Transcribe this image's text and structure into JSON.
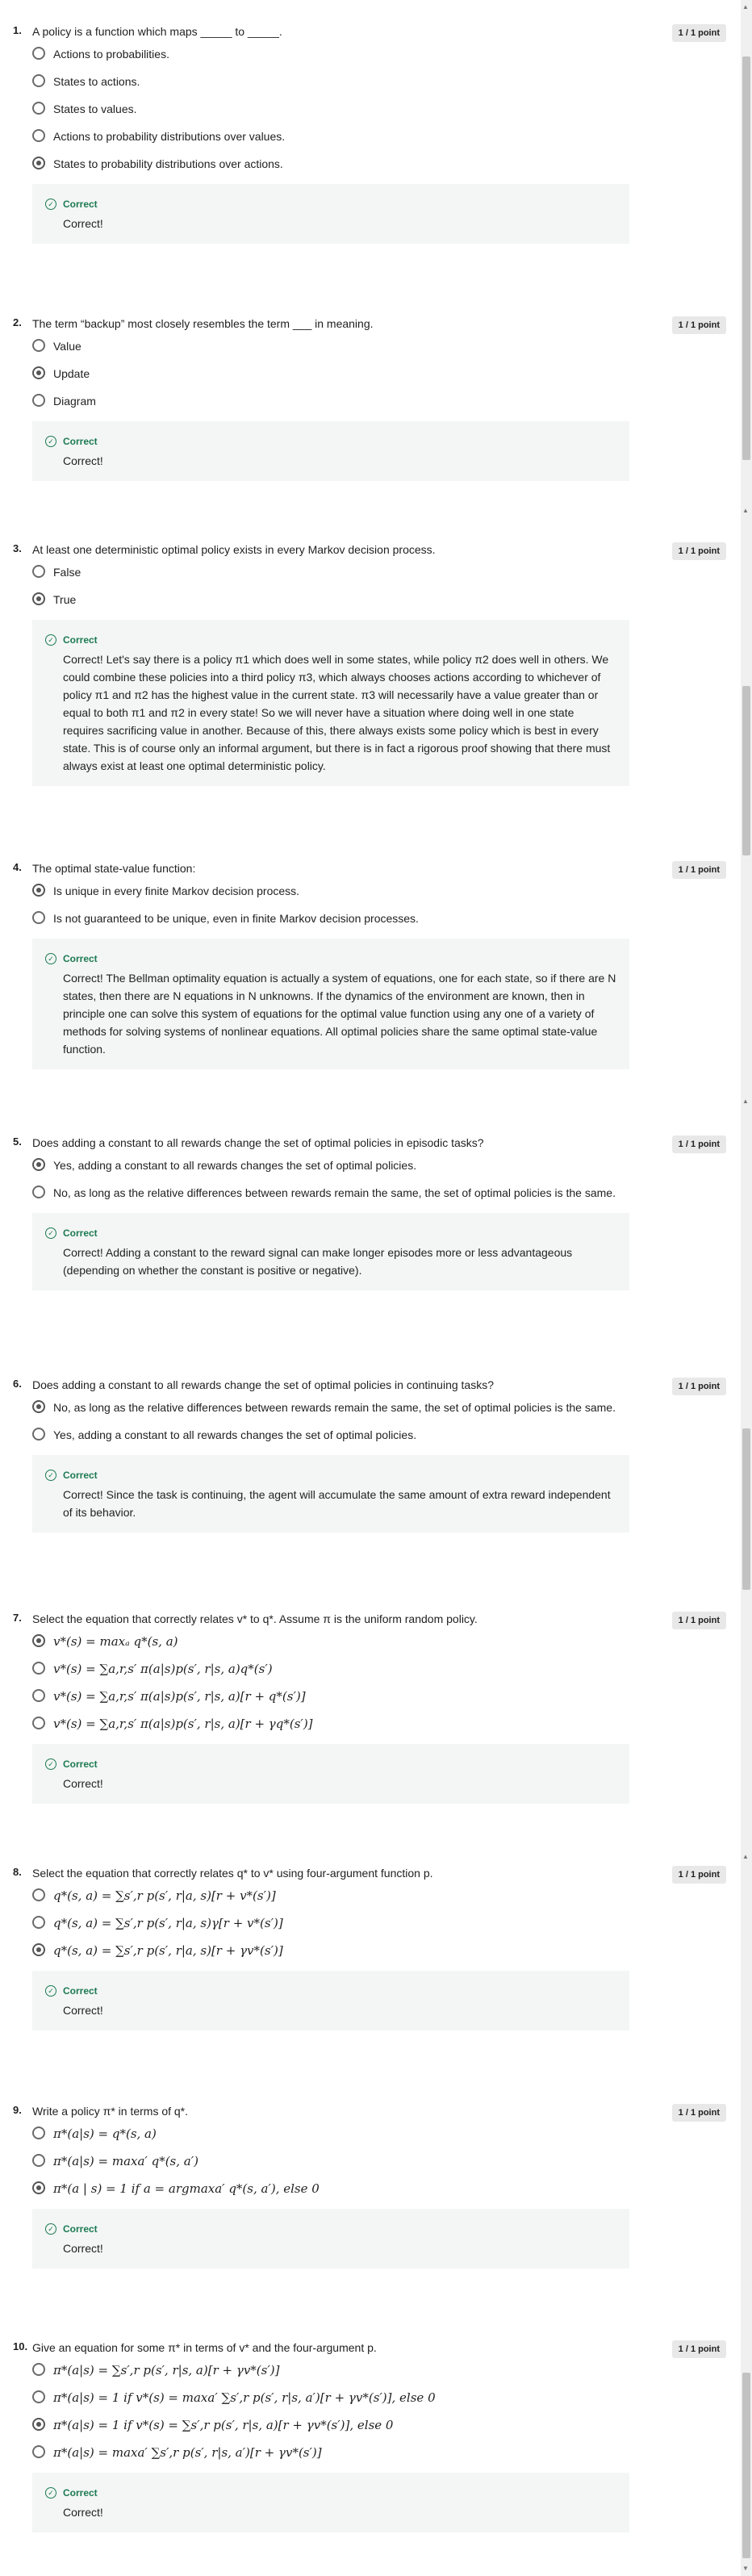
{
  "points_label": "1 / 1 point",
  "feedback_status": "Correct",
  "questions": [
    {
      "number": "1.",
      "text": "A policy is a function which maps _____ to _____.",
      "options": [
        {
          "text": "Actions to probabilities.",
          "selected": false
        },
        {
          "text": "States to actions.",
          "selected": false
        },
        {
          "text": "States to values.",
          "selected": false
        },
        {
          "text": "Actions to probability distributions over values.",
          "selected": false
        },
        {
          "text": "States to probability distributions over actions.",
          "selected": true
        }
      ],
      "feedback": "Correct!"
    },
    {
      "number": "2.",
      "text": "The term “backup” most closely resembles the term ___ in meaning.",
      "options": [
        {
          "text": "Value",
          "selected": false
        },
        {
          "text": "Update",
          "selected": true
        },
        {
          "text": "Diagram",
          "selected": false
        }
      ],
      "feedback": "Correct!"
    },
    {
      "number": "3.",
      "text": "At least one deterministic optimal policy exists in every Markov decision process.",
      "options": [
        {
          "text": "False",
          "selected": false
        },
        {
          "text": "True",
          "selected": true
        }
      ],
      "feedback": "Correct! Let's say there is a policy π1 which does well in some states, while policy π2 does well in others. We could combine these policies into a third policy π3, which always chooses actions according to whichever of policy π1 and π2 has the highest value in the current state.  π3 will necessarily have a value greater than or equal to both π1 and π2 in every state! So we will never have a situation where doing well in one state requires sacrificing value in another.  Because of this, there always exists some policy which is best in every state. This is of course only an informal argument, but there is in fact a rigorous proof showing that there must always exist at least one optimal deterministic policy."
    },
    {
      "number": "4.",
      "text": "The optimal state-value function:",
      "options": [
        {
          "text": "Is unique in every finite Markov decision process.",
          "selected": true
        },
        {
          "text": "Is not guaranteed to be unique, even in finite Markov decision processes.",
          "selected": false
        }
      ],
      "feedback": "Correct! The Bellman optimality equation is actually a system of equations, one for each state, so if there are N states, then there are N equations in N unknowns. If the dynamics  of the environment are known, then in principle one can solve this system of equations for the optimal value function using any one of a variety of methods for solving systems of nonlinear equations. All optimal policies share the same optimal state-value function."
    },
    {
      "number": "5.",
      "text": "Does adding a constant to all rewards change the set of optimal policies in episodic tasks?",
      "options": [
        {
          "text": "Yes, adding a constant to all rewards changes the set of optimal policies.",
          "selected": true
        },
        {
          "text": "No, as long as the relative differences between rewards remain the same, the set of optimal policies is the same.",
          "selected": false
        }
      ],
      "feedback": "Correct! Adding a constant to the reward signal can make longer episodes more or less advantageous (depending on whether the constant is positive or negative)."
    },
    {
      "number": "6.",
      "text": "Does adding a constant to all rewards change the set of optimal policies in continuing tasks?",
      "options": [
        {
          "text": "No, as long as the relative differences between rewards remain the same, the set of optimal policies is the same.",
          "selected": true
        },
        {
          "text": "Yes, adding a constant to all rewards changes the set of optimal policies.",
          "selected": false
        }
      ],
      "feedback": "Correct! Since the task is continuing, the agent will accumulate the same amount of extra reward independent of its behavior."
    },
    {
      "number": "7.",
      "text": "Select the equation that correctly relates v* to q*. Assume π is the uniform random policy.",
      "math": true,
      "options": [
        {
          "text": "v*(s) = maxₐ q*(s, a)",
          "selected": true
        },
        {
          "text": "v*(s) = ∑a,r,s′ π(a|s)p(s′, r|s, a)q*(s′)",
          "selected": false
        },
        {
          "text": "v*(s) = ∑a,r,s′ π(a|s)p(s′, r|s, a)[r + q*(s′)]",
          "selected": false
        },
        {
          "text": "v*(s) = ∑a,r,s′ π(a|s)p(s′, r|s, a)[r + γq*(s′)]",
          "selected": false
        }
      ],
      "feedback": "Correct!"
    },
    {
      "number": "8.",
      "text": "Select the equation that correctly relates q* to v* using  four-argument function p.",
      "math": true,
      "options": [
        {
          "text": "q*(s, a) = ∑s′,r p(s′, r|a, s)[r + v*(s′)]",
          "selected": false
        },
        {
          "text": "q*(s, a) = ∑s′,r p(s′, r|a, s)γ[r + v*(s′)]",
          "selected": false
        },
        {
          "text": "q*(s, a) = ∑s′,r p(s′, r|a, s)[r + γv*(s′)]",
          "selected": true
        }
      ],
      "feedback": "Correct!"
    },
    {
      "number": "9.",
      "text": "Write a policy π* in terms of q*.",
      "math": true,
      "options": [
        {
          "text": "π*(a|s) = q*(s, a)",
          "selected": false
        },
        {
          "text": "π*(a|s) = maxa′ q*(s, a′)",
          "selected": false
        },
        {
          "text": "π*(a | s) = 1 if a = argmaxa′ q*(s, a′), else 0",
          "selected": true
        }
      ],
      "feedback": "Correct!"
    },
    {
      "number": "10.",
      "text": "Give an equation for some π* in terms of v* and the four-argument p.",
      "math": true,
      "options": [
        {
          "text": "π*(a|s) = ∑s′,r p(s′, r|s, a)[r + γv*(s′)]",
          "selected": false
        },
        {
          "text": "π*(a|s) = 1 if v*(s) = maxa′ ∑s′,r p(s′, r|s, a′)[r + γv*(s′)],  else 0",
          "selected": false
        },
        {
          "text": "π*(a|s) = 1 if v*(s) = ∑s′,r p(s′, r|s, a)[r + γv*(s′)],  else 0",
          "selected": true
        },
        {
          "text": "π*(a|s) = maxa′ ∑s′,r p(s′, r|s, a′)[r + γv*(s′)]",
          "selected": false
        }
      ],
      "feedback": "Correct!"
    }
  ]
}
